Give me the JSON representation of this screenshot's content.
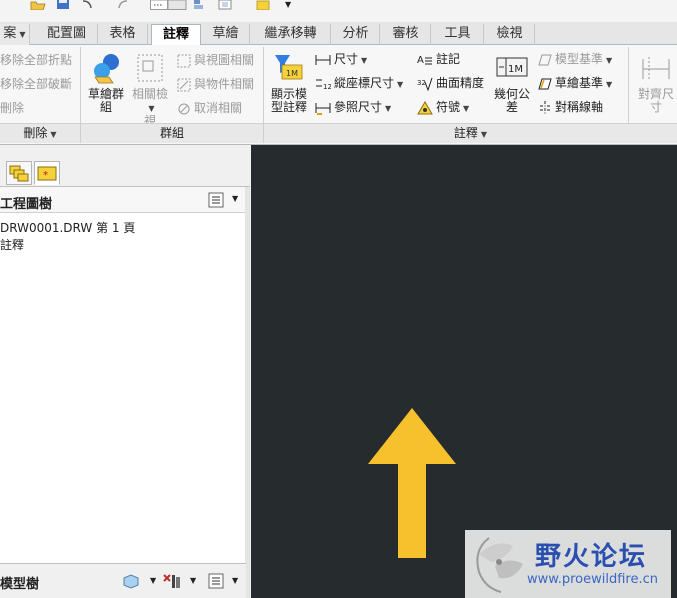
{
  "tabs": [
    {
      "label": "案",
      "has_dropdown": true
    },
    {
      "label": "配置圖"
    },
    {
      "label": "表格"
    },
    {
      "label": "註釋",
      "active": true
    },
    {
      "label": "草繪"
    },
    {
      "label": "繼承移轉"
    },
    {
      "label": "分析"
    },
    {
      "label": "審核"
    },
    {
      "label": "工具"
    },
    {
      "label": "檢視"
    }
  ],
  "ribbon": {
    "delete_group": {
      "items": [
        "移除全部折點",
        "移除全部破斷",
        "刪除"
      ],
      "footer": "刪除"
    },
    "group_group": {
      "sketch_group_line1": "草繪群",
      "sketch_group_line2": "組",
      "related_view_line1": "相關檢",
      "related_view_line2": "視",
      "items": [
        "與視圖相關",
        "與物件相關",
        "取消相關"
      ],
      "footer": "群組"
    },
    "annotation_group": {
      "show_model_line1": "顯示模",
      "show_model_line2": "型註釋",
      "dimension": "尺寸",
      "ordinate_dimension": "縱座標尺寸",
      "reference_dimension": "參照尺寸",
      "note": "註記",
      "surface_finish": "曲面精度",
      "symbol": "符號",
      "gtol_line1": "幾何公",
      "gtol_line2": "差",
      "model_datum": "模型基準",
      "sketch_datum": "草繪基準",
      "symmetry_line": "對稱線軸",
      "align_dim_line1": "對齊尺",
      "align_dim_line2": "寸",
      "footer": "註釋",
      "gtol_icon_text": "1M",
      "surface_icon_text": "32",
      "dim_icon_text": "12"
    }
  },
  "left_panel": {
    "drawing_tree_title": "工程圖樹",
    "drawing_file": "DRW0001.DRW 第 1 頁",
    "annotations_node": "註釋",
    "model_tree_title": "模型樹"
  },
  "watermark": {
    "title": "野火论坛",
    "url": "www.proewildfire.cn"
  },
  "colors": {
    "canvas_bg": "#262b2d",
    "arrow": "#f7c12e",
    "watermark_title": "#2a4fb0"
  }
}
